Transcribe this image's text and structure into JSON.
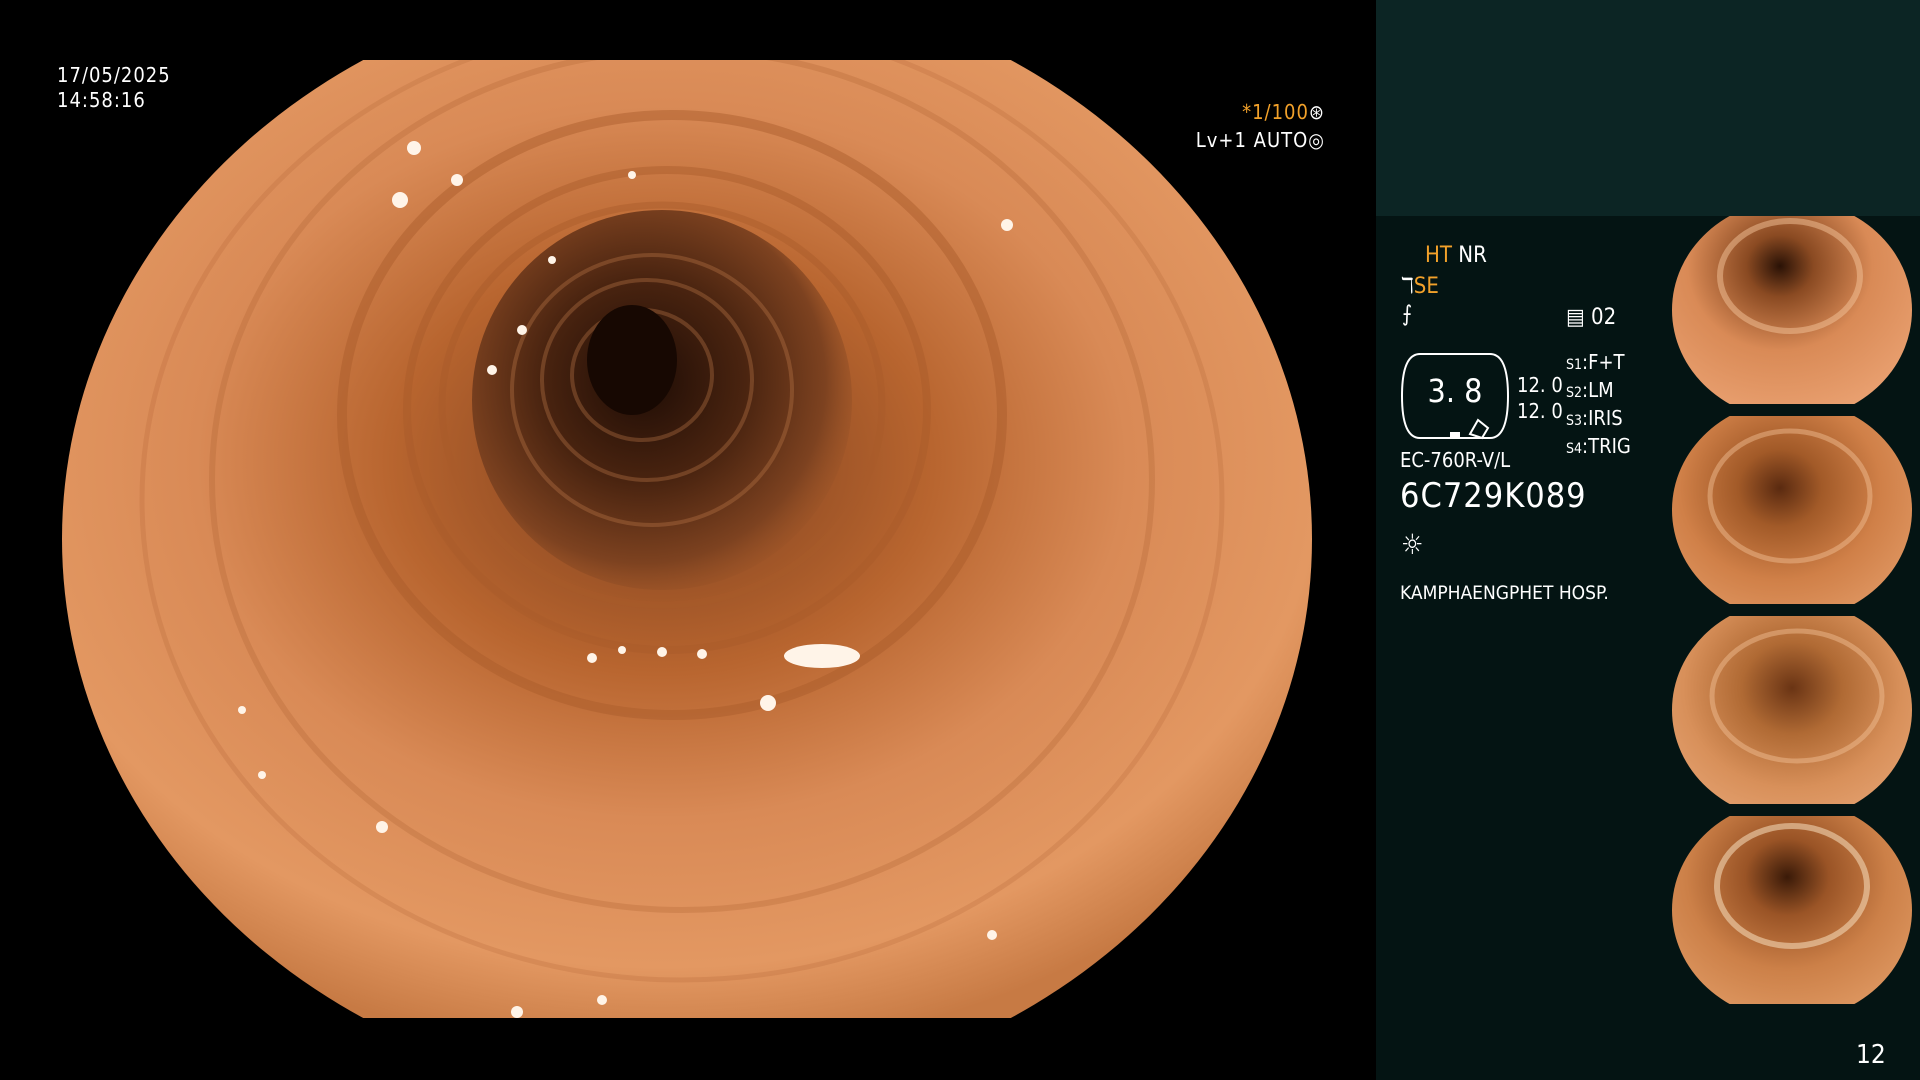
{
  "overlay": {
    "date": "17/05/2025",
    "time": "14:58:16",
    "shutter": "*1/100",
    "shutter_icon": "aperture-icon",
    "light_level": "Lv+1 AUTO",
    "light_icon": "iris-icon"
  },
  "panel": {
    "ht": "HT",
    "nr": "NR",
    "se": "SE",
    "se_icon": "structure-enhance-icon",
    "freeze_icon": "freeze-icon",
    "memory_count": "02",
    "memory_icon": "memory-card-icon",
    "zoom_value": "3. 8",
    "val1": "12. 0",
    "val2": "12. 0",
    "s_labels": [
      "S1",
      "S2",
      "S3",
      "S4"
    ],
    "s_values": [
      "F+T",
      "LM",
      "IRIS",
      "TRIG"
    ],
    "scope_model": "EC-760R-V/L",
    "serial": "6C729K089",
    "lamp_icon": "light-source-icon",
    "hospital": "KAMPHAENGPHET HOSP."
  },
  "thumbnails": [
    {
      "label": "thumbnail-1"
    },
    {
      "label": "thumbnail-2"
    },
    {
      "label": "thumbnail-3"
    },
    {
      "label": "thumbnail-4"
    }
  ],
  "page_number": "12",
  "colors": {
    "accent_orange": "#f2a12a",
    "panel_bg": "#041413",
    "panel_top_bg": "#0c2524",
    "mucosa": "#d98a56"
  }
}
